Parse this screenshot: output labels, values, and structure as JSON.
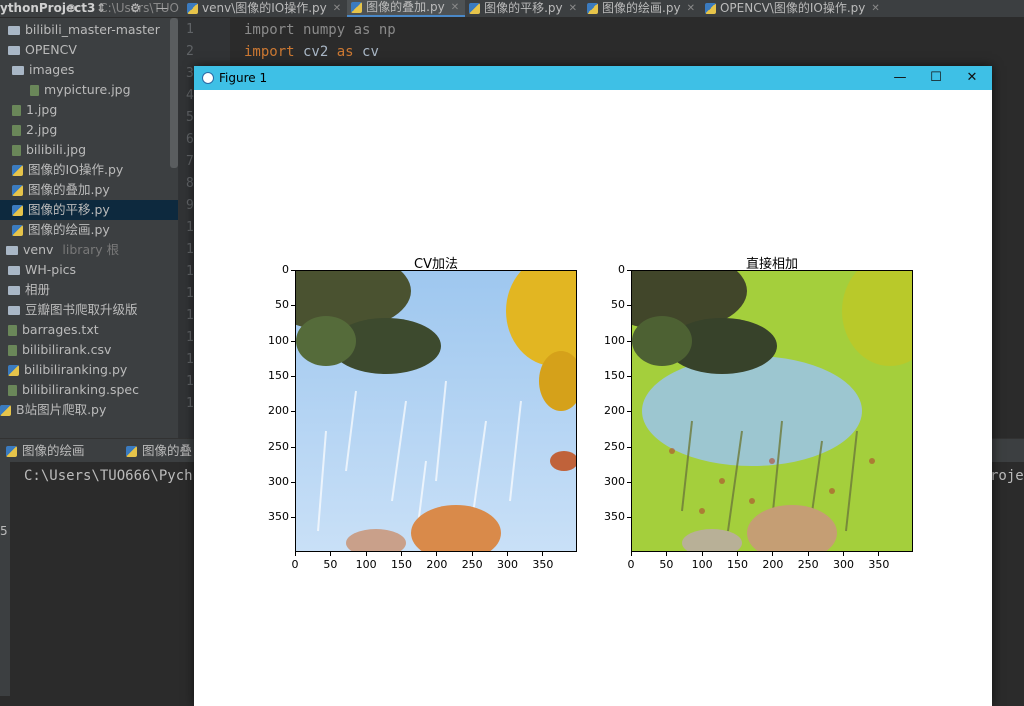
{
  "ide": {
    "project_name": "ythonProject3",
    "project_path": "C:\\Users\\TUO",
    "tabs": [
      {
        "label": "venv\\图像的IO操作.py",
        "active": false
      },
      {
        "label": "图像的叠加.py",
        "active": true
      },
      {
        "label": "图像的平移.py",
        "active": false
      },
      {
        "label": "图像的绘画.py",
        "active": false
      },
      {
        "label": "OPENCV\\图像的IO操作.py",
        "active": false
      }
    ],
    "tree": [
      {
        "label": "bilibili_master-master",
        "type": "folder"
      },
      {
        "label": "OPENCV",
        "type": "folder"
      },
      {
        "label": "images",
        "type": "folder"
      },
      {
        "label": "mypicture.jpg",
        "type": "image"
      },
      {
        "label": "1.jpg",
        "type": "image"
      },
      {
        "label": "2.jpg",
        "type": "image"
      },
      {
        "label": "bilibili.jpg",
        "type": "image"
      },
      {
        "label": "图像的IO操作.py",
        "type": "python"
      },
      {
        "label": "图像的叠加.py",
        "type": "python"
      },
      {
        "label": "图像的平移.py",
        "type": "python",
        "selected": true
      },
      {
        "label": "图像的绘画.py",
        "type": "python"
      },
      {
        "label": "venv",
        "type": "folder",
        "suffix": "library 根"
      },
      {
        "label": "WH-pics",
        "type": "folder"
      },
      {
        "label": "相册",
        "type": "folder"
      },
      {
        "label": "豆瓣图书爬取升级版",
        "type": "folder"
      },
      {
        "label": "barrages.txt",
        "type": "text"
      },
      {
        "label": "bilibilirank.csv",
        "type": "text"
      },
      {
        "label": "bilibiliranking.py",
        "type": "python"
      },
      {
        "label": "bilibiliranking.spec",
        "type": "text"
      },
      {
        "label": "B站图片爬取.py",
        "type": "python"
      }
    ],
    "line_numbers": [
      "1",
      "2",
      "3",
      "4",
      "5",
      "6",
      "7",
      "8",
      "9",
      "10",
      "11",
      "12",
      "13",
      "14",
      "15",
      "16",
      "17",
      "18"
    ],
    "code": {
      "line1_a": "import",
      "line1_b": " numpy ",
      "line1_c": "as",
      "line1_d": " np",
      "line2_a": "import",
      "line2_b": " cv2 ",
      "line2_c": "as",
      "line2_d": " cv"
    },
    "run_tabs": [
      "图像的绘画",
      "图像的叠"
    ],
    "console_line": "C:\\Users\\TUO666\\Pych",
    "console_right": "rojec",
    "console_gutter_glyph": "5"
  },
  "figure_window": {
    "title": "Figure 1",
    "controls": {
      "minimize": "—",
      "maximize": "☐",
      "close": "✕"
    }
  },
  "chart_data": [
    {
      "type": "image",
      "title": "CV加法",
      "xlim": [
        0,
        399
      ],
      "ylim": [
        399,
        0
      ],
      "xticks": [
        "0",
        "50",
        "100",
        "150",
        "200",
        "250",
        "300",
        "350"
      ],
      "yticks": [
        "0",
        "50",
        "100",
        "150",
        "200",
        "250",
        "300",
        "350"
      ],
      "grid": false
    },
    {
      "type": "image",
      "title": "直接相加",
      "xlim": [
        0,
        399
      ],
      "ylim": [
        399,
        0
      ],
      "xticks": [
        "0",
        "50",
        "100",
        "150",
        "200",
        "250",
        "300",
        "350"
      ],
      "yticks": [
        "0",
        "50",
        "100",
        "150",
        "200",
        "250",
        "300",
        "350"
      ],
      "grid": false
    }
  ],
  "colors": {
    "titlebar": "#3ec0e6",
    "selection": "#0d293e",
    "keyword": "#cc7832"
  }
}
